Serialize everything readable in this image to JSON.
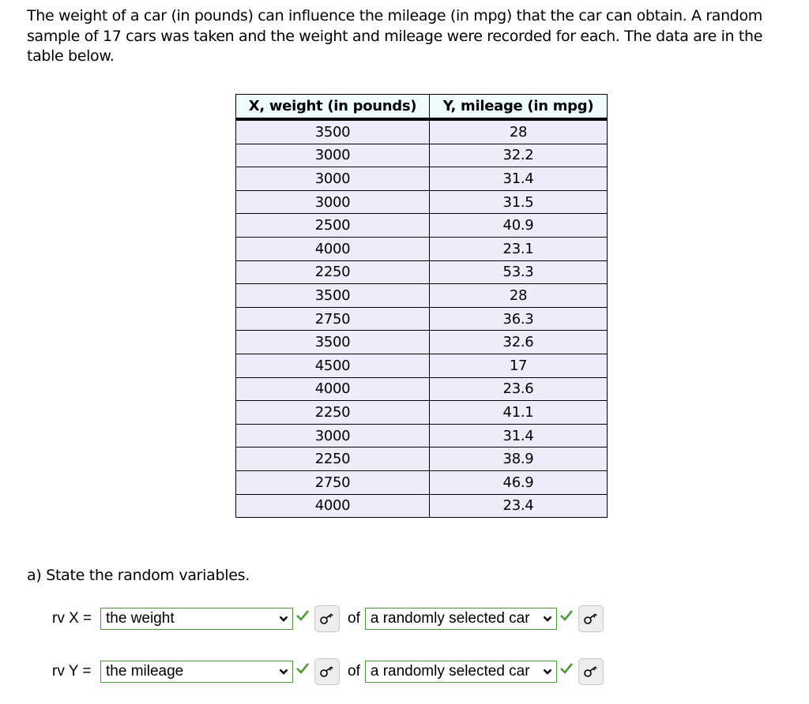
{
  "intro": "The weight of a car (in pounds) can influence the mileage (in mpg) that the car can obtain. A random sample of 17 cars was taken and the weight and mileage were recorded for each. The data are in the table below.",
  "table": {
    "headers": [
      "X, weight (in pounds)",
      "Y, mileage (in mpg)"
    ],
    "rows": [
      [
        "3500",
        "28"
      ],
      [
        "3000",
        "32.2"
      ],
      [
        "3000",
        "31.4"
      ],
      [
        "3000",
        "31.5"
      ],
      [
        "2500",
        "40.9"
      ],
      [
        "4000",
        "23.1"
      ],
      [
        "2250",
        "53.3"
      ],
      [
        "3500",
        "28"
      ],
      [
        "2750",
        "36.3"
      ],
      [
        "3500",
        "32.6"
      ],
      [
        "4500",
        "17"
      ],
      [
        "4000",
        "23.6"
      ],
      [
        "2250",
        "41.1"
      ],
      [
        "3000",
        "31.4"
      ],
      [
        "2250",
        "38.9"
      ],
      [
        "2750",
        "46.9"
      ],
      [
        "4000",
        "23.4"
      ]
    ]
  },
  "question_a": {
    "prompt": "a) State the random variables.",
    "rows": [
      {
        "label": "rv X =",
        "variable_value": "the weight",
        "variable_status": "correct",
        "connector": "of",
        "population_value": "a randomly selected car",
        "population_status": "correct"
      },
      {
        "label": "rv Y =",
        "variable_value": "the mileage",
        "variable_status": "correct",
        "connector": "of",
        "population_value": "a randomly selected car",
        "population_status": "correct"
      }
    ]
  },
  "icons": {
    "check": "check-icon",
    "key": "key-icon",
    "chevron": "chevron-down-icon"
  },
  "colors": {
    "header_bg": "#eefcfd",
    "row_bg": "#ececfb",
    "correct_green": "#4d9a3a"
  }
}
